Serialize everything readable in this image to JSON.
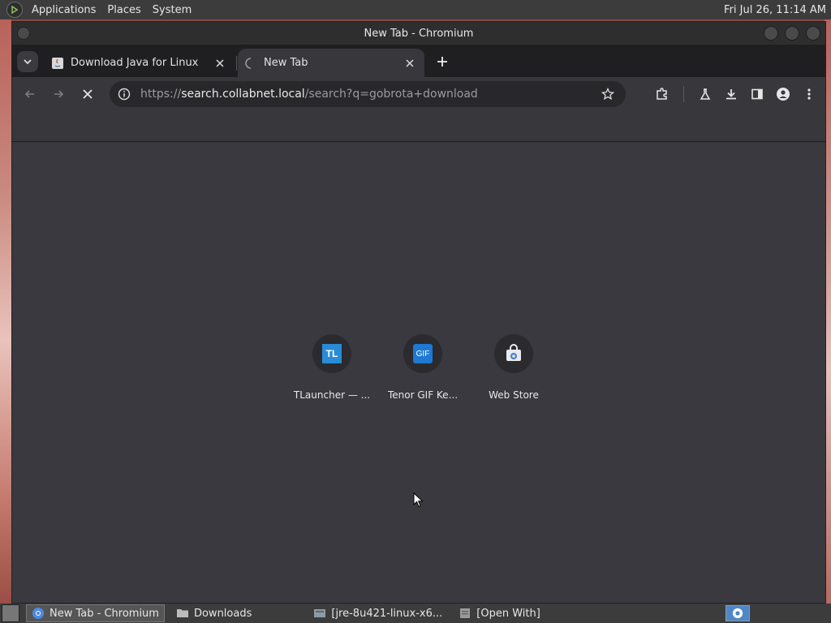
{
  "top_panel": {
    "menus": [
      "Applications",
      "Places",
      "System"
    ],
    "clock": "Fri Jul 26, 11:14 AM"
  },
  "window": {
    "title": "New Tab - Chromium"
  },
  "tabs": [
    {
      "title": "Download Java for Linux",
      "favicon": "java-icon",
      "active": false
    },
    {
      "title": "New Tab",
      "favicon": "loading-spinner-icon",
      "active": true
    }
  ],
  "omnibox": {
    "scheme": "https://",
    "host": "search.collabnet.local",
    "path": "/search?q=gobrota+download"
  },
  "shortcuts": [
    {
      "label": "TLauncher — ...",
      "icon_text": "TL"
    },
    {
      "label": "Tenor GIF Ke...",
      "icon_text": "GIF"
    },
    {
      "label": "Web Store",
      "icon_text": ""
    }
  ],
  "taskbar": {
    "items": [
      {
        "label": "New Tab - Chromium",
        "active": true
      },
      {
        "label": "Downloads",
        "active": false
      },
      {
        "label": "[jre-8u421-linux-x6...",
        "active": false
      },
      {
        "label": "[Open With]",
        "active": false
      }
    ]
  }
}
